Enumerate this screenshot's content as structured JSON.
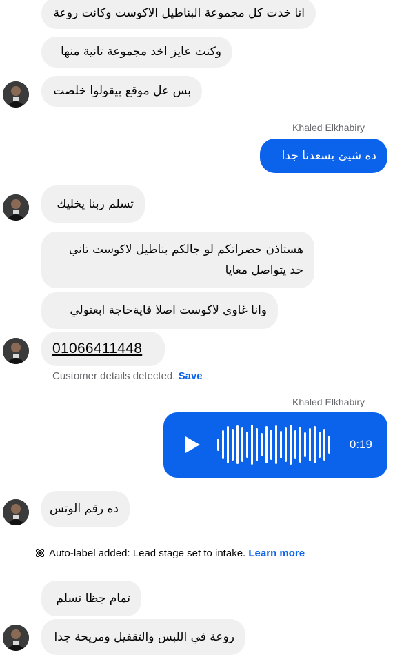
{
  "messages": {
    "m1": "انا خدت كل مجموعة البناطيل الاكوست وكانت روعة",
    "m2": "وكنت عايز اخد مجموعة تانية منها",
    "m3": "بس عل موقع بيقولوا خلصت",
    "m4": "ده شيئ يسعدنا جدا",
    "m5": "تسلم ربنا يخليك",
    "m6": "هستاذن حضراتكم لو جالكم بناطيل لاكوست تاني حد يتواصل معايا",
    "m7": "وانا غاوي لاكوست اصلا فايةحاجة ابعتولي",
    "m8": "01066411448",
    "m9": "ده رقم الوتس",
    "m10": "تمام جظا تسلم",
    "m11": "روعة في اللبس والتقفيل ومريحة جدا"
  },
  "sender": {
    "name_1": "Khaled Elkhabiry",
    "name_2": "Khaled Elkhabiry"
  },
  "customer_details": {
    "text": "Customer details detected.",
    "action": "Save"
  },
  "voice_message": {
    "duration": "0:19",
    "icon": "play-icon"
  },
  "auto_label": {
    "icon": "atom-icon",
    "text": "Auto-label added: Lead stage set to intake.",
    "link": "Learn more"
  },
  "colors": {
    "outgoing_bubble": "#0a63ea",
    "incoming_bubble": "#f0f0f0",
    "link": "#0a63ea",
    "meta_text": "#65676b"
  }
}
